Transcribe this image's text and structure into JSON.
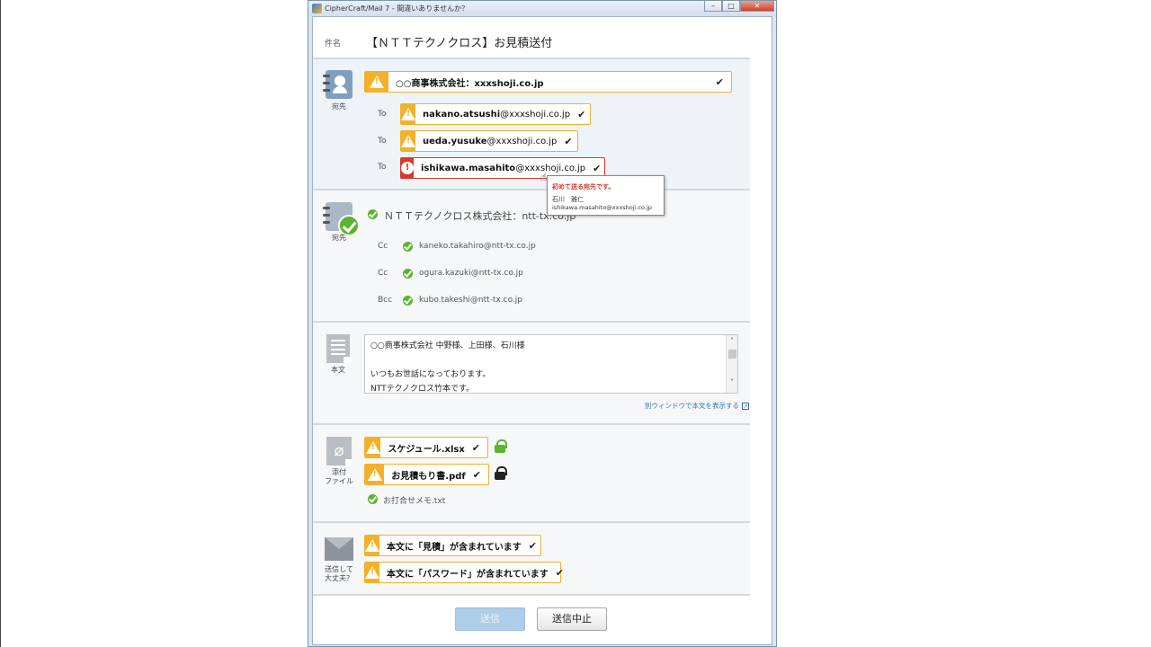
{
  "window": {
    "title": "CipherCraft/Mail 7 - 間違いありませんか？",
    "buttons": {
      "minimize": "–",
      "maximize": "□",
      "close": "✕"
    }
  },
  "subject": {
    "label": "件名",
    "value": "【ＮＴＴテクノクロス】お見積送付"
  },
  "external_recipients": {
    "side_label": "宛先",
    "domain_chip": "○○商事株式会社：xxxshoji.co.jp",
    "rows": [
      {
        "type": "To",
        "name": "nakano.atsushi",
        "domain": "@xxxshoji.co.jp",
        "status": "warning"
      },
      {
        "type": "To",
        "name": "ueda.yusuke",
        "domain": "@xxxshoji.co.jp",
        "status": "warning"
      },
      {
        "type": "To",
        "name": "ishikawa.masahito",
        "domain": "@xxxshoji.co.jp",
        "status": "error"
      }
    ],
    "tooltip": {
      "title": "初めて送る宛先です。",
      "person": "石川　雅仁",
      "email": "ishikawa.masahito@xxxshoji.co.jp"
    }
  },
  "internal_recipients": {
    "side_label": "宛先",
    "domain": "ＮＴＴテクノクロス株式会社：ntt-tx.co.jp",
    "rows": [
      {
        "type": "Cc",
        "address": "kaneko.takahiro@ntt-tx.co.jp"
      },
      {
        "type": "Cc",
        "address": "ogura.kazuki@ntt-tx.co.jp"
      },
      {
        "type": "Bcc",
        "address": "kubo.takeshi@ntt-tx.co.jp"
      }
    ]
  },
  "body": {
    "side_label": "本文",
    "lines": [
      "○○商事株式会社  中野様、上田様、石川様",
      "",
      "いつもお世話になっております。",
      "NTTテクノクロス竹本です。"
    ],
    "open_window_link": "別ウィンドウで本文を表示する"
  },
  "attachments": {
    "side_label_1": "添付",
    "side_label_2": "ファイル",
    "files": [
      {
        "name": "スケジュール.xlsx",
        "lock": "green"
      },
      {
        "name": "お見積もり書.pdf",
        "lock": "black"
      }
    ],
    "ok_file": "お打合せメモ.txt"
  },
  "checks": {
    "side_label_1": "送信して",
    "side_label_2": "大丈夫？",
    "items": [
      "本文に「見積」が含まれています",
      "本文に「パスワード」が含まれています"
    ]
  },
  "footer": {
    "send": "送信",
    "cancel": "送信中止"
  },
  "colors": {
    "warning": "#f3b12a",
    "error": "#d9382b",
    "ok": "#5bb52f",
    "accent": "#3a6fb5"
  }
}
